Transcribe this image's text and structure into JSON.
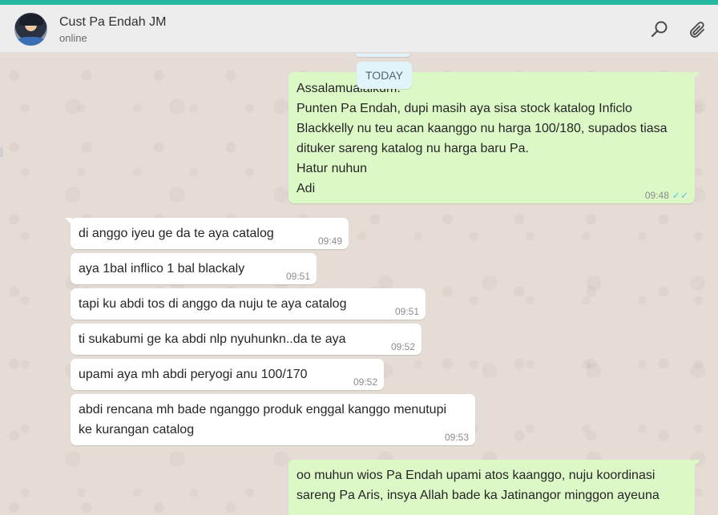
{
  "header": {
    "contact_name": "Cust Pa Endah JM",
    "status": "online",
    "icons": [
      "search-icon",
      "attach-icon"
    ]
  },
  "chat": {
    "date_label": "TODAY",
    "messages": [
      {
        "direction": "out",
        "text": "Assalamualaikum.\nPunten Pa Endah, dupi masih aya sisa stock katalog Inficlo\nBlackkelly nu teu acan kaanggo nu harga 100/180, supados tiasa\ndituker sareng katalog nu harga baru Pa.\nHatur nuhun\nAdi",
        "time": "09:48",
        "read": true
      },
      {
        "direction": "in",
        "text": "di anggo iyeu ge da te aya catalog",
        "time": "09:49"
      },
      {
        "direction": "in",
        "text": "aya 1bal inflico 1 bal blackaly",
        "time": "09:51"
      },
      {
        "direction": "in",
        "text": "tapi ku abdi tos di anggo da nuju te aya catalog",
        "time": "09:51"
      },
      {
        "direction": "in",
        "text": "ti sukabumi ge ka abdi nlp nyuhunkn..da te aya",
        "time": "09:52"
      },
      {
        "direction": "in",
        "text": "upami aya mh abdi peryogi anu 100/170",
        "time": "09:52"
      },
      {
        "direction": "in",
        "text": "abdi rencana mh bade nganggo produk enggal kanggo menutupi\nke kurangan catalog",
        "time": "09:53"
      },
      {
        "direction": "out",
        "text": "oo muhun wios Pa Endah upami atos kaanggo, nuju koordinasi\nsareng Pa Aris, insya Allah bade ka Jatinangor minggon ayeuna",
        "time": ""
      }
    ]
  },
  "colors": {
    "accent_strip": "#26b9a0",
    "outgoing_bubble": "#dcf8c6",
    "incoming_bubble": "#ffffff",
    "chat_background": "#e5ddd5",
    "read_ticks": "#4fc3f7"
  }
}
